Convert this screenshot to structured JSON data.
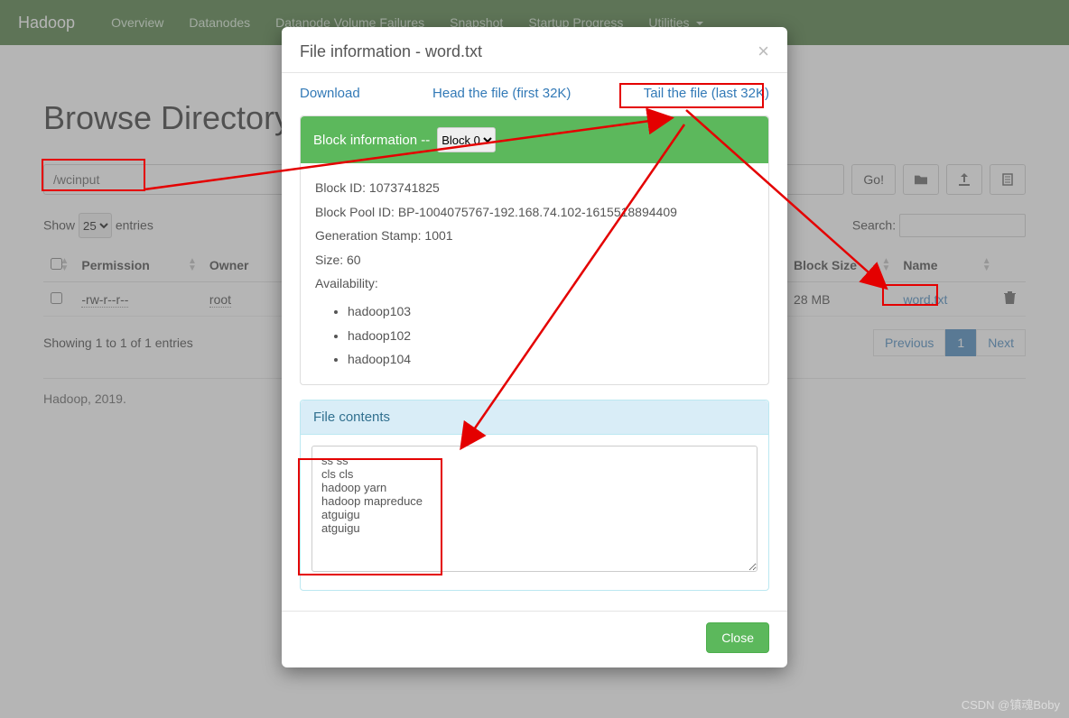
{
  "nav": {
    "brand": "Hadoop",
    "items": [
      "Overview",
      "Datanodes",
      "Datanode Volume Failures",
      "Snapshot",
      "Startup Progress",
      "Utilities"
    ]
  },
  "page": {
    "title": "Browse Directory",
    "path_value": "/wcinput",
    "go_label": "Go!",
    "show_prefix": "Show",
    "show_suffix": "entries",
    "show_value": "25",
    "search_label": "Search:",
    "info_text": "Showing 1 to 1 of 1 entries",
    "prev": "Previous",
    "page_num": "1",
    "next": "Next",
    "footer": "Hadoop, 2019."
  },
  "table": {
    "headers": [
      "Permission",
      "Owner",
      "Block Size",
      "Name"
    ],
    "row": {
      "permission": "-rw-r--r--",
      "owner": "root",
      "blocksize_tail": "28 MB",
      "name": "word.txt"
    }
  },
  "modal": {
    "title": "File information - word.txt",
    "links": {
      "download": "Download",
      "head": "Head the file (first 32K)",
      "tail": "Tail the file (last 32K)"
    },
    "block_info_label": "Block information --",
    "block_select": "Block 0",
    "block_id_label": "Block ID:",
    "block_id": "1073741825",
    "pool_label": "Block Pool ID:",
    "pool_id": "BP-1004075767-192.168.74.102-1615518894409",
    "genstamp_label": "Generation Stamp:",
    "genstamp": "1001",
    "size_label": "Size:",
    "size": "60",
    "avail_label": "Availability:",
    "avail": [
      "hadoop103",
      "hadoop102",
      "hadoop104"
    ],
    "contents_label": "File contents",
    "contents_text": "ss ss\ncls cls\nhadoop yarn\nhadoop mapreduce\natguigu\natguigu",
    "close": "Close"
  },
  "watermark": "CSDN @镇魂Boby"
}
